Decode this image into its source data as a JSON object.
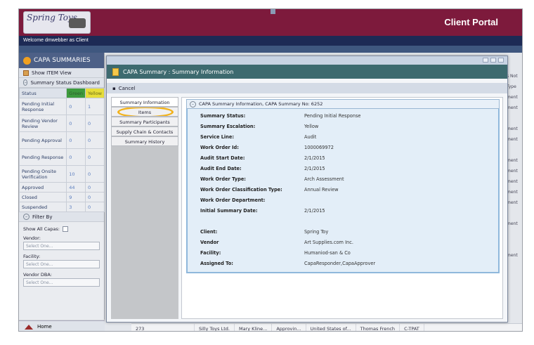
{
  "header": {
    "logo_text": "Spring Toys",
    "portal_title": "Client Portal",
    "welcome": "Welcome dmwebber as Client"
  },
  "left_panel": {
    "title": "CAPA SUMMARIES",
    "show_item_view": "Show ITEM View",
    "dashboard_title": "Summary Status Dashboard",
    "status_header": "Status",
    "green_header": "Green",
    "yellow_header": "Yellow",
    "rows": [
      {
        "status": "Pending Initial Response",
        "green": "0",
        "yellow": "1"
      },
      {
        "status": "Pending Vendor Review",
        "green": "0",
        "yellow": "0"
      },
      {
        "status": "Pending Approval",
        "green": "0",
        "yellow": "0"
      },
      {
        "status": "Pending Response",
        "green": "0",
        "yellow": "0"
      },
      {
        "status": "Pending Onsite Verification",
        "green": "10",
        "yellow": "0"
      },
      {
        "status": "Approved",
        "green": "44",
        "yellow": "0"
      },
      {
        "status": "Closed",
        "green": "9",
        "yellow": "0"
      },
      {
        "status": "Suspended",
        "green": "3",
        "yellow": "0"
      }
    ],
    "filter_by": "Filter By",
    "show_all_capas": "Show All Capas:",
    "vendor_label": "Vendor:",
    "facility_label": "Facility:",
    "vendor_dba_label": "Vendor DBA:",
    "select_placeholder": "Select One...",
    "home": "Home"
  },
  "background": {
    "right_col_header_1": "s Not",
    "right_col_header_2": "Type",
    "right_col_cells": [
      "ment",
      "ment",
      "",
      "ment",
      "ment",
      "",
      "ment",
      "ment",
      "ment",
      "ment",
      "ment",
      "",
      "ment",
      "",
      "",
      "ment"
    ],
    "bottom_row": [
      "273",
      "Silly Toys Ltd.",
      "Mary Kline...",
      "Approvin...",
      "United States of...",
      "Thomas French",
      "C-TPAT"
    ]
  },
  "modal": {
    "title": "CAPA Summary : Summary Information",
    "cancel": "Cancel",
    "tabs": [
      "Summary Information",
      "Items",
      "Summary Participants",
      "Supply Chain & Contacts",
      "Summary History"
    ],
    "section_title": "CAPA Summary Information, CAPA Summary No: 6252",
    "fields": [
      {
        "label": "Summary Status:",
        "value": "Pending Initial Response"
      },
      {
        "label": "Summary Escalation:",
        "value": "Yellow"
      },
      {
        "label": "Service Line:",
        "value": "Audit"
      },
      {
        "label": "Work Order Id:",
        "value": "1000069972"
      },
      {
        "label": "Audit Start Date:",
        "value": "2/1/2015"
      },
      {
        "label": "Audit End Date:",
        "value": "2/1/2015"
      },
      {
        "label": "Work Order Type:",
        "value": "Arch Assessment"
      },
      {
        "label": "Work Order Classification Type:",
        "value": "Annual Review"
      },
      {
        "label": "Work Order Department:",
        "value": ""
      },
      {
        "label": "Initial Summary Date:",
        "value": "2/1/2015"
      },
      {
        "label": "Client:",
        "value": "Spring Toy"
      },
      {
        "label": "Vendor",
        "value": "Art Supplies.com Inc."
      },
      {
        "label": "Facility:",
        "value": "Humaniod-san & Co"
      },
      {
        "label": "Assigned To:",
        "value": "CapaResponder,CapaApprover"
      }
    ]
  }
}
